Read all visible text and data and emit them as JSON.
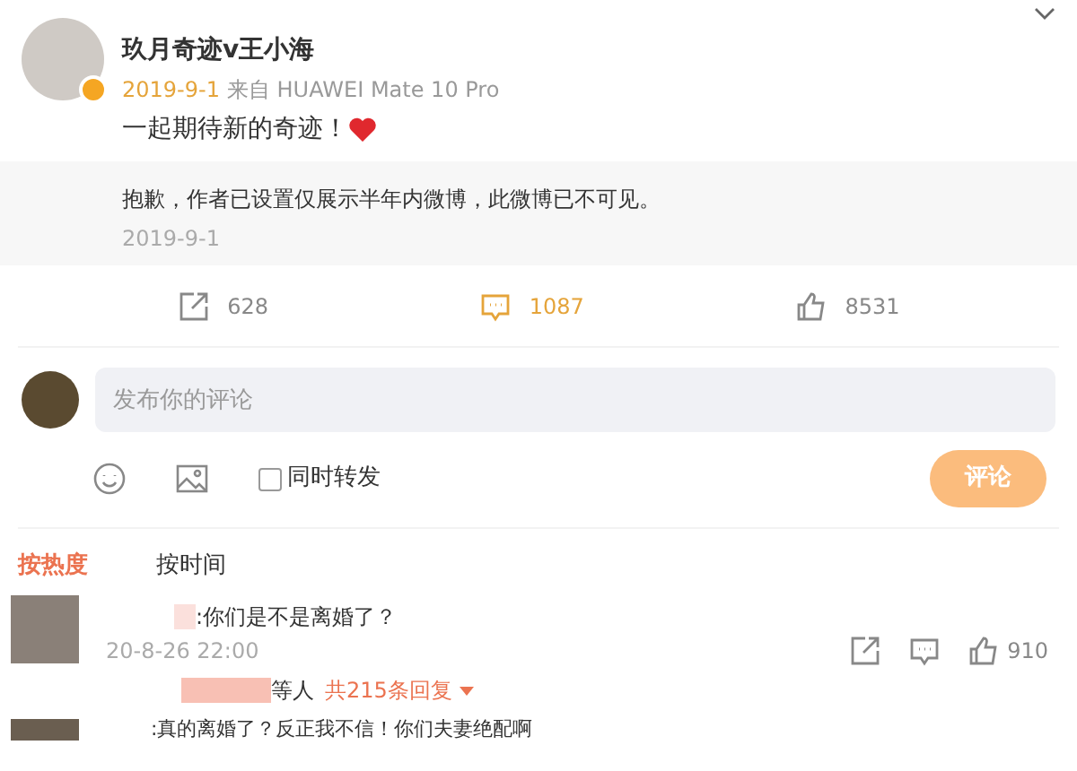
{
  "post": {
    "author": "玖月奇迹v王小海",
    "verified": true,
    "date": "2019-9-1",
    "source": "来自 HUAWEI Mate 10 Pro",
    "text": "一起期待新的奇迹！"
  },
  "notice": {
    "text": "抱歉，作者已设置仅展示半年内微博，此微博已不可见。",
    "date": "2019-9-1"
  },
  "actions": [
    {
      "kind": "repost",
      "count": "628",
      "selected": false
    },
    {
      "kind": "comment",
      "count": "1087",
      "selected": true
    },
    {
      "kind": "like",
      "count": "8531",
      "selected": false
    }
  ],
  "composer": {
    "placeholder": "发布你的评论",
    "repost_checkbox": {
      "label": "同时转发",
      "checked": false
    },
    "submit": "评论"
  },
  "sort_tabs": [
    {
      "label": "按热度",
      "selected": true
    },
    {
      "label": "按时间",
      "selected": false
    }
  ],
  "comments": [
    {
      "text": ":你们是不是离婚了？",
      "time": "20-8-26 22:00",
      "likes": "910",
      "replies_suffix": "等人",
      "replies_link": "共215条回复"
    },
    {
      "text": ":真的离婚了？反正我不信！你们夫妻绝配啊"
    }
  ]
}
